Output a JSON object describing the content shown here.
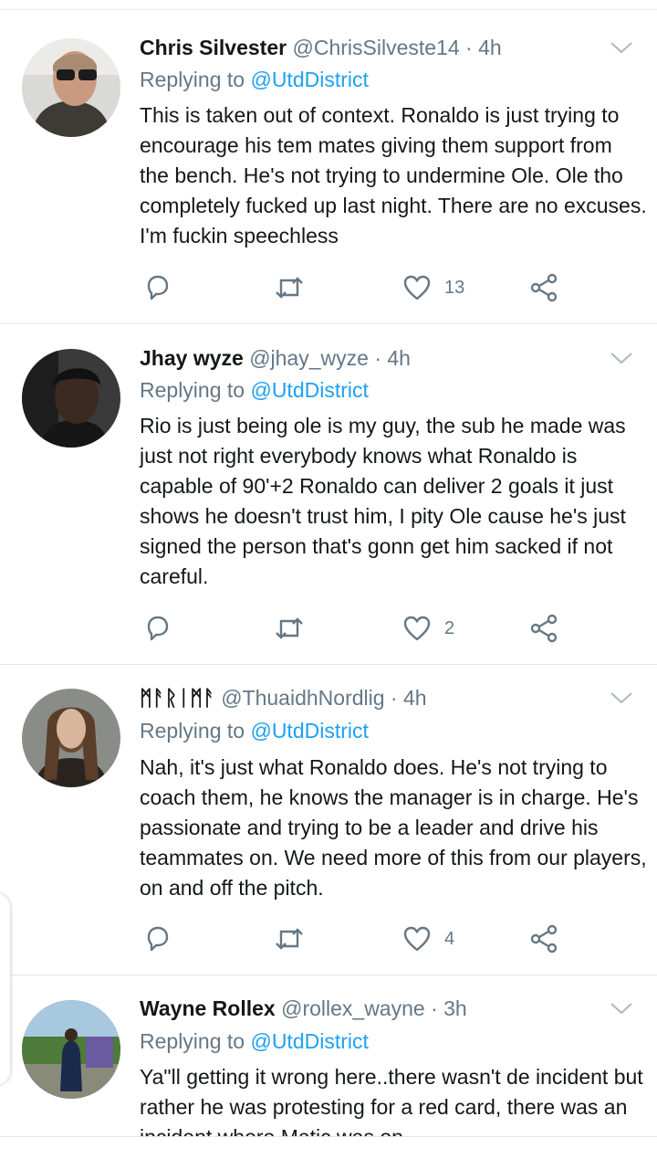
{
  "tweets": [
    {
      "name": "Chris Silvester",
      "handle": "@ChrisSilveste14",
      "time": "· 4h",
      "replying_prefix": "Replying to",
      "replying_to": "@UtdDistrict",
      "text": "This is taken out of context. Ronaldo is just trying to encourage his tem mates giving them support from the bench. He's not trying to undermine Ole. Ole tho completely fucked up last night. There are no excuses. I'm fuckin speechless",
      "likes": "13"
    },
    {
      "name": "Jhay wyze",
      "handle": "@jhay_wyze",
      "time": "· 4h",
      "replying_prefix": "Replying to",
      "replying_to": "@UtdDistrict",
      "text": "Rio is just being ole is my guy, the sub he made was just not right everybody knows what Ronaldo is capable of 90'+2 Ronaldo can deliver 2 goals it  just shows he doesn't trust him, I pity Ole cause he's just signed the person that's gonn get him sacked if not careful.",
      "likes": "2"
    },
    {
      "name": "ᛗᚨᚱᛁᛗᚨ",
      "handle": "@ThuaidhNordlig",
      "time": "· 4h",
      "replying_prefix": "Replying to",
      "replying_to": "@UtdDistrict",
      "text": "Nah, it's just what Ronaldo does. He's not trying to coach them, he knows the manager is in charge. He's passionate and trying to be a leader and drive his teammates on. We need more of this from our players, on and off the pitch.",
      "likes": "4"
    },
    {
      "name": "Wayne Rollex",
      "handle": "@rollex_wayne",
      "time": "· 3h",
      "replying_prefix": "Replying to",
      "replying_to": "@UtdDistrict",
      "text": "Ya\"ll getting it wrong here..there wasn't de incident but rather he was protesting for a red card, there was an incident where Matic was on",
      "likes": ""
    }
  ],
  "colors": {
    "name": "#14171a",
    "secondary": "#657786",
    "mention": "#1da1f2",
    "divider": "#e1e8ed"
  },
  "icons": [
    "reply-icon",
    "retweet-icon",
    "like-icon",
    "share-icon",
    "chevron-down-icon"
  ]
}
